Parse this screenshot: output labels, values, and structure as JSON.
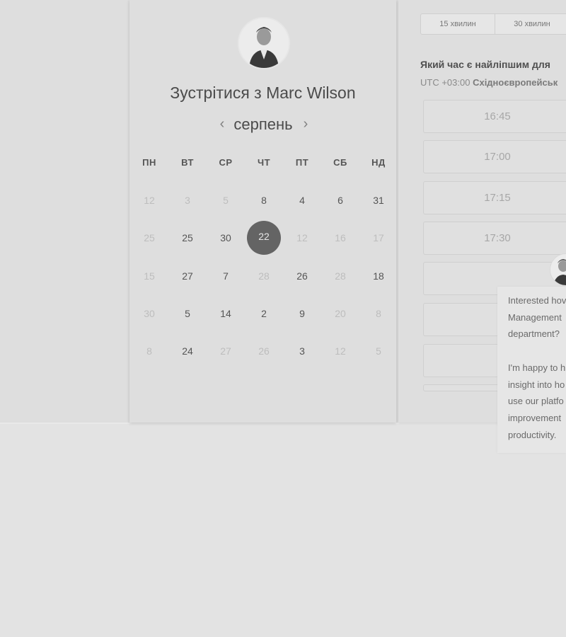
{
  "host": {
    "title": "Зустрітися з Marc Wilson",
    "avatar": "person-avatar"
  },
  "calendar": {
    "month": "серпень",
    "prev_icon": "chevron-left-icon",
    "next_icon": "chevron-right-icon",
    "weekdays": [
      "ПН",
      "ВТ",
      "СР",
      "ЧТ",
      "ПТ",
      "СБ",
      "НД"
    ],
    "rows": [
      [
        {
          "d": "12",
          "m": true
        },
        {
          "d": "3",
          "m": true
        },
        {
          "d": "5",
          "m": true
        },
        {
          "d": "8",
          "m": false
        },
        {
          "d": "4",
          "m": false
        },
        {
          "d": "6",
          "m": false
        },
        {
          "d": "31",
          "m": false
        }
      ],
      [
        {
          "d": "25",
          "m": true
        },
        {
          "d": "25",
          "m": false
        },
        {
          "d": "30",
          "m": false
        },
        {
          "d": "22",
          "m": false,
          "s": true
        },
        {
          "d": "12",
          "m": true
        },
        {
          "d": "16",
          "m": true
        },
        {
          "d": "17",
          "m": true
        }
      ],
      [
        {
          "d": "15",
          "m": true
        },
        {
          "d": "27",
          "m": false
        },
        {
          "d": "7",
          "m": false
        },
        {
          "d": "28",
          "m": true
        },
        {
          "d": "26",
          "m": false
        },
        {
          "d": "28",
          "m": true
        },
        {
          "d": "18",
          "m": false
        }
      ],
      [
        {
          "d": "30",
          "m": true
        },
        {
          "d": "5",
          "m": false
        },
        {
          "d": "14",
          "m": false
        },
        {
          "d": "2",
          "m": false
        },
        {
          "d": "9",
          "m": false
        },
        {
          "d": "20",
          "m": true
        },
        {
          "d": "8",
          "m": true
        }
      ],
      [
        {
          "d": "8",
          "m": true
        },
        {
          "d": "24",
          "m": false
        },
        {
          "d": "27",
          "m": true
        },
        {
          "d": "26",
          "m": true
        },
        {
          "d": "3",
          "m": false
        },
        {
          "d": "12",
          "m": true
        },
        {
          "d": "5",
          "m": true
        }
      ]
    ]
  },
  "scheduler": {
    "durations": [
      "15 хвилин",
      "30 хвилин"
    ],
    "question": "Який час є найліпшим для",
    "tz_prefix": "UTC +03:00",
    "tz_name": "Східноєвропейськ",
    "slots": [
      "16:45",
      "17:00",
      "17:15",
      "17:30",
      "",
      "",
      ""
    ]
  },
  "chat": {
    "avatar": "person-avatar",
    "lines": [
      "Interested hov",
      "Management",
      "department?",
      "",
      "I'm happy to h",
      "insight into ho",
      "use our platfo",
      "improvement",
      "productivity."
    ]
  },
  "colors": {
    "selected_day": "#646464",
    "page_bg": "#e3e3e3"
  }
}
